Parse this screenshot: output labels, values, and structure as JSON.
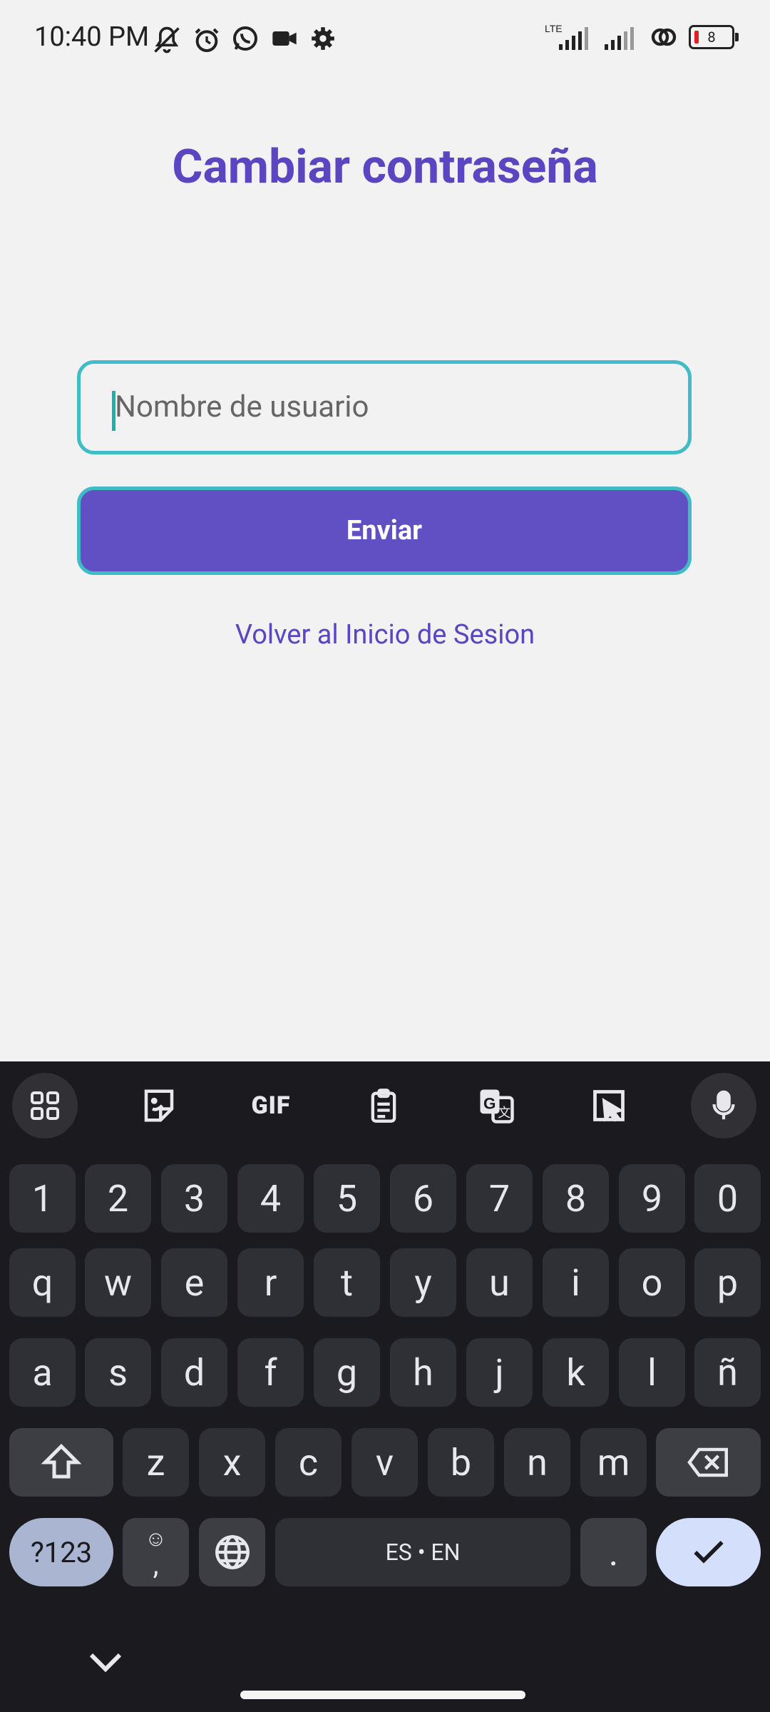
{
  "status_bar": {
    "time": "10:40 PM",
    "left_icons": [
      "mute-icon",
      "alarm-icon",
      "whatsapp-icon",
      "video-camera-icon",
      "settings-gear-icon"
    ],
    "network_label": "LTE",
    "battery_level": "8"
  },
  "page": {
    "title": "Cambiar contraseña",
    "username_placeholder": "Nombre de usuario",
    "username_value": "",
    "send_label": "Enviar",
    "back_link": "Volver al Inicio de Sesion"
  },
  "colors": {
    "accent": "#5b45c0",
    "button_bg": "#6150c4",
    "border": "#3fbcc6",
    "background": "#f2f2f2",
    "keyboard_bg": "#1b1b1f"
  },
  "keyboard": {
    "toolbar": {
      "gif_label": "GIF",
      "icons": [
        "apps-grid-icon",
        "sticker-icon",
        "gif-icon",
        "clipboard-icon",
        "translate-icon",
        "screenshot-icon",
        "microphone-icon"
      ]
    },
    "row_numbers": [
      "1",
      "2",
      "3",
      "4",
      "5",
      "6",
      "7",
      "8",
      "9",
      "0"
    ],
    "row1": [
      "q",
      "w",
      "e",
      "r",
      "t",
      "y",
      "u",
      "i",
      "o",
      "p"
    ],
    "row2": [
      "a",
      "s",
      "d",
      "f",
      "g",
      "h",
      "j",
      "k",
      "l",
      "ñ"
    ],
    "row3": [
      "z",
      "x",
      "c",
      "v",
      "b",
      "n",
      "m"
    ],
    "symbols_label": "?123",
    "comma_label": ",",
    "space_label": "ES • EN",
    "period_label": "."
  }
}
